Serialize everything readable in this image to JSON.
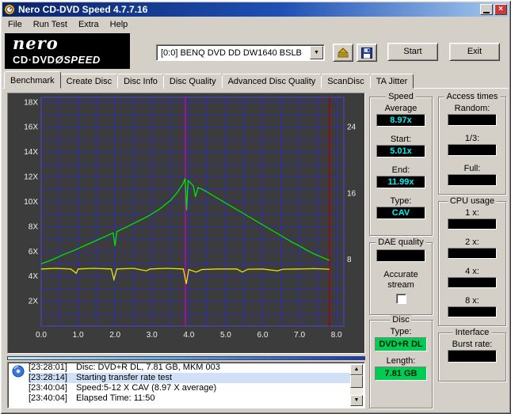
{
  "window": {
    "title": "Nero CD-DVD Speed 4.7.7.16"
  },
  "menu": {
    "items": [
      "File",
      "Run Test",
      "Extra",
      "Help"
    ]
  },
  "logo": {
    "name": "nero",
    "product": "CD·DVD",
    "gauge": "Ø",
    "speed": "SPEED"
  },
  "toolbar": {
    "drive": "[0:0]  BENQ DVD DD DW1640 BSLB",
    "start_label": "Start",
    "exit_label": "Exit"
  },
  "tabs": [
    "Benchmark",
    "Create Disc",
    "Disc Info",
    "Disc Quality",
    "Advanced Disc Quality",
    "ScanDisc",
    "TA Jitter"
  ],
  "active_tab": "Benchmark",
  "panels": {
    "speed": {
      "title": "Speed",
      "items": [
        {
          "label": "Average",
          "value": "8.97x"
        },
        {
          "label": "Start:",
          "value": "5.01x"
        },
        {
          "label": "End:",
          "value": "11.99x"
        },
        {
          "label": "Type:",
          "value": "CAV"
        }
      ]
    },
    "access": {
      "title": "Access times",
      "items": [
        {
          "label": "Random:",
          "value": ""
        },
        {
          "label": "1/3:",
          "value": ""
        },
        {
          "label": "Full:",
          "value": ""
        }
      ]
    },
    "cpu": {
      "title": "CPU usage",
      "items": [
        {
          "label": "1 x:",
          "value": ""
        },
        {
          "label": "2 x:",
          "value": ""
        },
        {
          "label": "4 x:",
          "value": ""
        },
        {
          "label": "8 x:",
          "value": ""
        }
      ]
    },
    "dae": {
      "title": "DAE quality",
      "value": "",
      "accurate_line1": "Accurate",
      "accurate_line2": "stream"
    },
    "disc": {
      "title": "Disc",
      "type_label": "Type:",
      "type_value": "DVD+R DL",
      "length_label": "Length:",
      "length_value": "7.81 GB"
    },
    "interface": {
      "title": "Interface",
      "burst_label": "Burst rate:",
      "burst_value": ""
    }
  },
  "log": {
    "rows": [
      {
        "time": "[23:28:01]",
        "text": "Disc: DVD+R DL, 7.81 GB, MKM 003"
      },
      {
        "time": "[23:28:14]",
        "text": "Starting transfer rate test"
      },
      {
        "time": "[23:40:04]",
        "text": "Speed:5-12 X CAV (8.97 X average)"
      },
      {
        "time": "[23:40:04]",
        "text": "Elapsed Time: 11:50"
      }
    ]
  },
  "chart_data": {
    "type": "line",
    "title": "",
    "xlabel": "",
    "ylabel": "",
    "xlim": [
      0,
      8.2
    ],
    "ylim": [
      0,
      18.4
    ],
    "grid": {
      "x_step": 0.5,
      "y_step": 1,
      "color": "#2b2bb4"
    },
    "x_ticks": [
      [
        0,
        "0.0"
      ],
      [
        1,
        "1.0"
      ],
      [
        2,
        "2.0"
      ],
      [
        3,
        "3.0"
      ],
      [
        4,
        "4.0"
      ],
      [
        5,
        "5.0"
      ],
      [
        6,
        "6.0"
      ],
      [
        7,
        "7.0"
      ],
      [
        8,
        "8.0"
      ]
    ],
    "y_ticks_left": [
      [
        2,
        "2X"
      ],
      [
        4,
        "4X"
      ],
      [
        6,
        "6X"
      ],
      [
        8,
        "8X"
      ],
      [
        10,
        "10X"
      ],
      [
        12,
        "12X"
      ],
      [
        14,
        "14X"
      ],
      [
        16,
        "16X"
      ],
      [
        18,
        "18X"
      ]
    ],
    "y_ticks_right": [
      [
        8,
        "8"
      ],
      [
        16,
        "16"
      ],
      [
        24,
        "24"
      ]
    ],
    "right_axis_ratio": 1.5,
    "markers": [
      {
        "name": "layer-break",
        "x": 3.905,
        "color": "#c000c0"
      },
      {
        "name": "disc-end",
        "x": 7.81,
        "color": "#aa0000"
      }
    ],
    "series": [
      {
        "name": "read-speed",
        "color": "#00e600",
        "points": [
          [
            0,
            5.01
          ],
          [
            0.3,
            5.35
          ],
          [
            0.6,
            5.75
          ],
          [
            0.9,
            6.1
          ],
          [
            1.2,
            6.5
          ],
          [
            1.5,
            6.9
          ],
          [
            1.8,
            7.3
          ],
          [
            1.95,
            7.5
          ],
          [
            2.0,
            6.45
          ],
          [
            2.05,
            7.6
          ],
          [
            2.3,
            7.95
          ],
          [
            2.6,
            8.4
          ],
          [
            2.9,
            8.85
          ],
          [
            3.2,
            9.4
          ],
          [
            3.5,
            10.1
          ],
          [
            3.7,
            10.8
          ],
          [
            3.85,
            11.5
          ],
          [
            3.9,
            11.9
          ],
          [
            3.94,
            9.3
          ],
          [
            3.98,
            11.7
          ],
          [
            4.05,
            11.5
          ],
          [
            4.12,
            11.3
          ],
          [
            4.18,
            10.4
          ],
          [
            4.25,
            11.15
          ],
          [
            4.4,
            10.95
          ],
          [
            4.6,
            10.6
          ],
          [
            4.8,
            10.25
          ],
          [
            5.0,
            9.9
          ],
          [
            5.2,
            9.55
          ],
          [
            5.4,
            9.2
          ],
          [
            5.6,
            8.85
          ],
          [
            5.8,
            8.5
          ],
          [
            6.0,
            8.15
          ],
          [
            6.2,
            7.8
          ],
          [
            6.4,
            7.45
          ],
          [
            6.6,
            7.1
          ],
          [
            6.8,
            6.75
          ],
          [
            7.0,
            6.45
          ],
          [
            7.2,
            6.1
          ],
          [
            7.4,
            5.8
          ],
          [
            7.6,
            5.55
          ],
          [
            7.81,
            5.3
          ]
        ]
      },
      {
        "name": "rotation-speed",
        "color": "#e6e600",
        "points": [
          [
            0,
            4.6
          ],
          [
            0.4,
            4.65
          ],
          [
            0.8,
            4.6
          ],
          [
            0.95,
            4.25
          ],
          [
            1.0,
            4.6
          ],
          [
            1.4,
            4.65
          ],
          [
            1.9,
            4.6
          ],
          [
            1.97,
            3.75
          ],
          [
            2.05,
            4.6
          ],
          [
            2.5,
            4.65
          ],
          [
            2.85,
            4.45
          ],
          [
            2.95,
            4.6
          ],
          [
            3.4,
            4.65
          ],
          [
            3.85,
            4.6
          ],
          [
            3.93,
            3.4
          ],
          [
            4.0,
            4.55
          ],
          [
            4.2,
            4.35
          ],
          [
            4.35,
            4.55
          ],
          [
            4.8,
            4.6
          ],
          [
            5.3,
            4.6
          ],
          [
            5.45,
            4.35
          ],
          [
            5.6,
            4.58
          ],
          [
            6.0,
            4.6
          ],
          [
            6.4,
            4.45
          ],
          [
            6.55,
            4.58
          ],
          [
            7.0,
            4.6
          ],
          [
            7.4,
            4.62
          ],
          [
            7.81,
            4.58
          ]
        ]
      }
    ]
  }
}
